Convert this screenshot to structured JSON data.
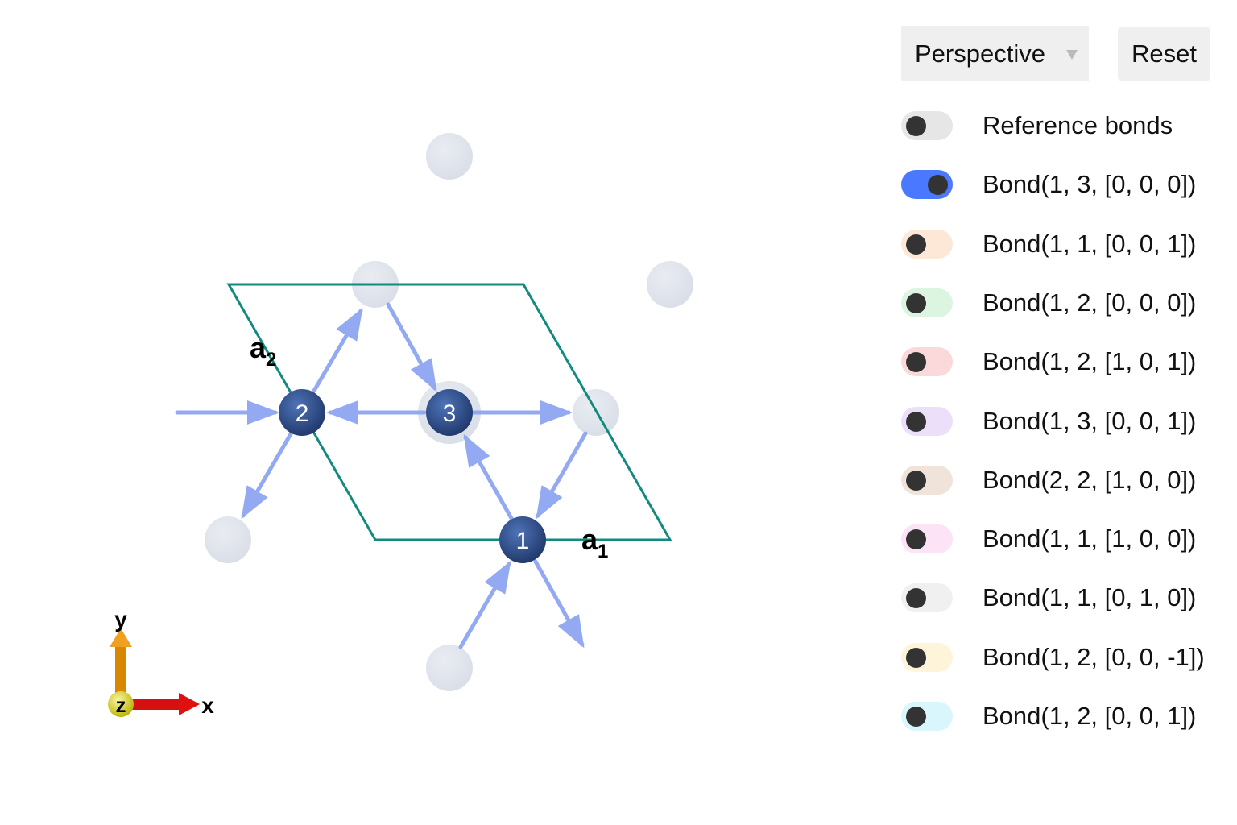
{
  "controls": {
    "projection": {
      "selected": "Perspective",
      "icon": "caret-down-icon"
    },
    "reset_label": "Reset"
  },
  "toggles": [
    {
      "label": "Reference bonds",
      "on": false,
      "color": "#e6e6e6"
    },
    {
      "label": "Bond(1, 3, [0, 0, 0])",
      "on": true,
      "color": "#4a78ff"
    },
    {
      "label": "Bond(1, 1, [0, 0, 1])",
      "on": false,
      "color": "#fde8d8"
    },
    {
      "label": "Bond(1, 2, [0, 0, 0])",
      "on": false,
      "color": "#dcf5e0"
    },
    {
      "label": "Bond(1, 2, [1, 0, 1])",
      "on": false,
      "color": "#fbd8da"
    },
    {
      "label": "Bond(1, 3, [0, 0, 1])",
      "on": false,
      "color": "#ecdff9"
    },
    {
      "label": "Bond(2, 2, [1, 0, 0])",
      "on": false,
      "color": "#f0e3d9"
    },
    {
      "label": "Bond(1, 1, [1, 0, 0])",
      "on": false,
      "color": "#fce3f5"
    },
    {
      "label": "Bond(1, 1, [0, 1, 0])",
      "on": false,
      "color": "#f0f0f0"
    },
    {
      "label": "Bond(1, 2, [0, 0, -1])",
      "on": false,
      "color": "#fdf4d9"
    },
    {
      "label": "Bond(1, 2, [0, 0, 1])",
      "on": false,
      "color": "#d8f6fc"
    }
  ],
  "scene": {
    "atoms": [
      "1",
      "2",
      "3"
    ],
    "lattice_labels": {
      "a1": "a",
      "a1_sub": "1",
      "a2": "a",
      "a2_sub": "2"
    },
    "axes": {
      "x": "x",
      "y": "y",
      "z": "z"
    },
    "colors": {
      "atom": "#2f4f8f",
      "ghost_atom": "#e1e5ec",
      "bond_arrow": "#8ea6f2",
      "cell": "#138a80",
      "x_axis": "#dd1111",
      "y_axis": "#e08a00",
      "z_axis": "#e6e22a"
    }
  }
}
